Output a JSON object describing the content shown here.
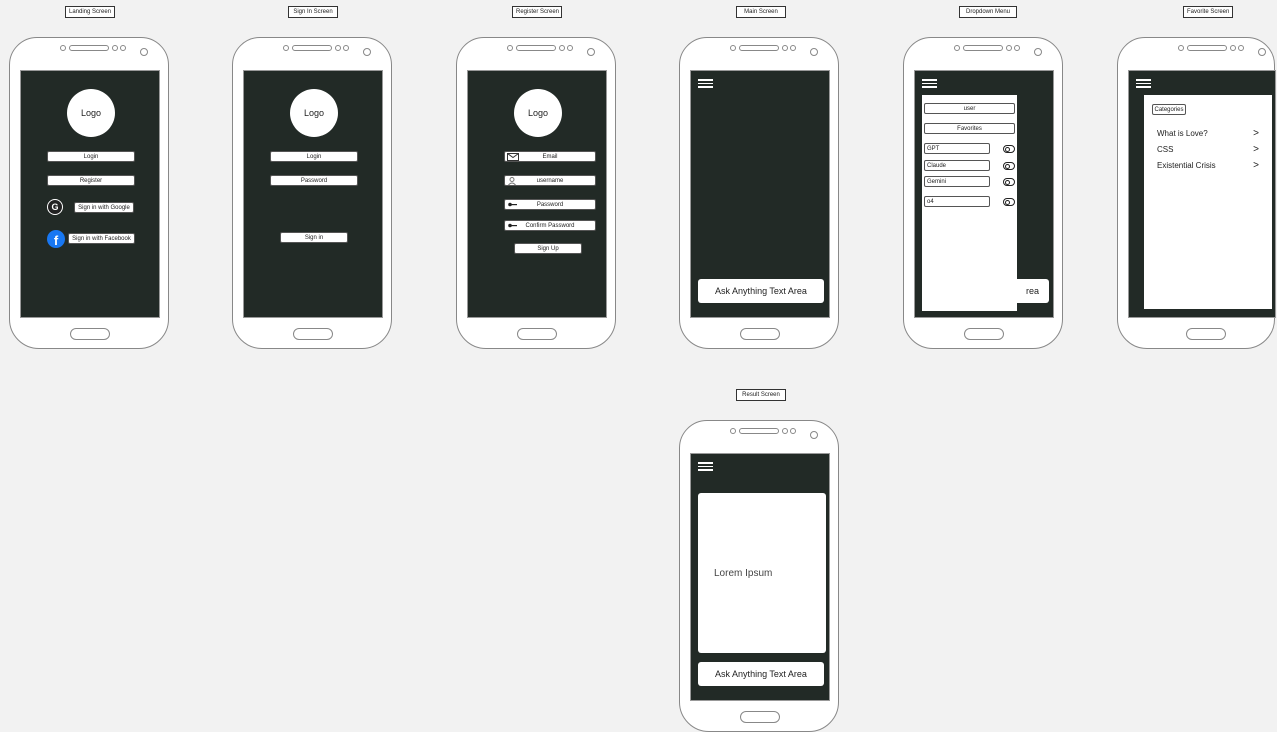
{
  "screens": {
    "landing": {
      "title": "Landing Screen",
      "logo": "Logo",
      "login": "Login",
      "register": "Register",
      "google": "Sign in with Google",
      "facebook": "Sign in with Facebook",
      "google_glyph": "G",
      "facebook_glyph": "f"
    },
    "signin": {
      "title": "Sign In Screen",
      "logo": "Logo",
      "login": "Login",
      "password": "Password",
      "signin": "Sign in"
    },
    "register": {
      "title": "Register Screen",
      "logo": "Logo",
      "email": "Email",
      "username": "username",
      "password": "Password",
      "confirm": "Confirm Password",
      "signup": "Sign Up"
    },
    "main": {
      "title": "Main Screen",
      "ask": "Ask Anything Text Area"
    },
    "dropdown": {
      "title": "Dropdown Menu",
      "user": "user",
      "favorites": "Favorites",
      "models": [
        "GPT",
        "Claude",
        "Gemini",
        "o4"
      ],
      "ask_partial": "rea"
    },
    "favorite": {
      "title": "Favorite Screen",
      "categories": "Categories",
      "items": [
        "What is Love?",
        "CSS",
        "Existential Crisis"
      ]
    },
    "result": {
      "title": "Result Screen",
      "content": "Lorem Ipsum",
      "ask": "Ask Anything Text Area"
    }
  },
  "colors": {
    "screen_bg": "#222a26",
    "facebook_blue": "#1877f2",
    "page_bg": "#f2f2f2"
  }
}
